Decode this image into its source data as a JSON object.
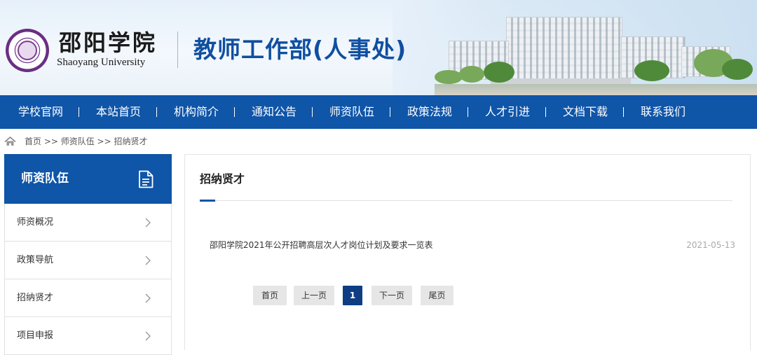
{
  "header": {
    "logo_cn": "邵阳学院",
    "logo_en": "Shaoyang University",
    "site_title": "教师工作部(人事处)"
  },
  "nav": {
    "items": [
      "学校官网",
      "本站首页",
      "机构简介",
      "通知公告",
      "师资队伍",
      "政策法规",
      "人才引进",
      "文档下载",
      "联系我们"
    ]
  },
  "breadcrumb": {
    "text": "首页 >> 师资队伍 >> 招纳贤才"
  },
  "sidebar": {
    "title": "师资队伍",
    "items": [
      {
        "label": "师资概况"
      },
      {
        "label": "政策导航"
      },
      {
        "label": "招纳贤才"
      },
      {
        "label": "项目申报"
      }
    ]
  },
  "main": {
    "title": "招纳贤才",
    "articles": [
      {
        "title": "邵阳学院2021年公开招聘高层次人才岗位计划及要求一览表",
        "date": "2021-05-13"
      }
    ]
  },
  "pagination": {
    "first": "首页",
    "prev": "上一页",
    "current": "1",
    "next": "下一页",
    "last": "尾页"
  },
  "colors": {
    "brand_blue": "#0f55a8",
    "title_blue": "#0f4fa0",
    "active_page": "#0f3d84"
  },
  "icons": [
    "university-seal-icon",
    "home-icon",
    "document-icon",
    "chevron-right-icon"
  ]
}
